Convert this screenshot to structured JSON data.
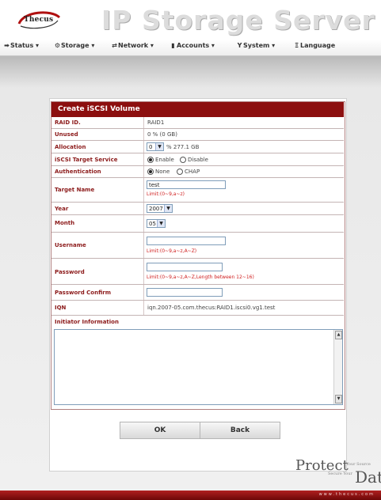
{
  "header": {
    "logo_text": "Thecus",
    "app_title": "IP Storage Server"
  },
  "menu": [
    {
      "label": "Status ▾",
      "icon": "arrow-icon"
    },
    {
      "label": "Storage ▾",
      "icon": "gear-icon"
    },
    {
      "label": "Network ▾",
      "icon": "network-icon"
    },
    {
      "label": "Accounts ▾",
      "icon": "accounts-icon"
    },
    {
      "label": "System ▾",
      "icon": "system-icon"
    },
    {
      "label": "Language",
      "icon": "language-icon"
    }
  ],
  "form": {
    "title": "Create iSCSI Volume",
    "rows": {
      "raid_id": {
        "label": "RAID ID.",
        "value": "RAID1"
      },
      "unused": {
        "label": "Unused",
        "value": "0 % (0 GB)"
      },
      "allocation": {
        "label": "Allocation",
        "select_value": "0",
        "suffix": "% 277.1 GB"
      },
      "target_service": {
        "label": "iSCSI Target Service",
        "options": [
          "Enable",
          "Disable"
        ],
        "selected": "Enable"
      },
      "authentication": {
        "label": "Authentication",
        "options": [
          "None",
          "CHAP"
        ],
        "selected": "None"
      },
      "target_name": {
        "label": "Target Name",
        "value": "test",
        "hint": "Limit:(0~9,a~z)"
      },
      "year": {
        "label": "Year",
        "value": "2007"
      },
      "month": {
        "label": "Month",
        "value": "05"
      },
      "username": {
        "label": "Username",
        "value": "",
        "hint": "Limit:(0~9,a~z,A~Z)"
      },
      "password": {
        "label": "Password",
        "value": "",
        "hint": "Limit:(0~9,a~z,A~Z,Length between 12~16)"
      },
      "password_confirm": {
        "label": "Password Confirm",
        "value": ""
      },
      "iqn": {
        "label": "IQN",
        "value": "iqn.2007-05.com.thecus:RAID1.iscsi0.vg1.test"
      },
      "initiator": {
        "label": "Initiator Information",
        "value": ""
      }
    }
  },
  "buttons": {
    "ok": "OK",
    "back": "Back"
  },
  "footer": {
    "tagline_protect": "Protect",
    "tagline_your_source": "Your Source",
    "tagline_secure_your": "Secure Your",
    "tagline_data": "Data",
    "url": "www.thecus.com"
  },
  "colors": {
    "header_red": "#8c0f0f",
    "label_red": "#8c1a1a",
    "hint_red": "#d02020"
  }
}
